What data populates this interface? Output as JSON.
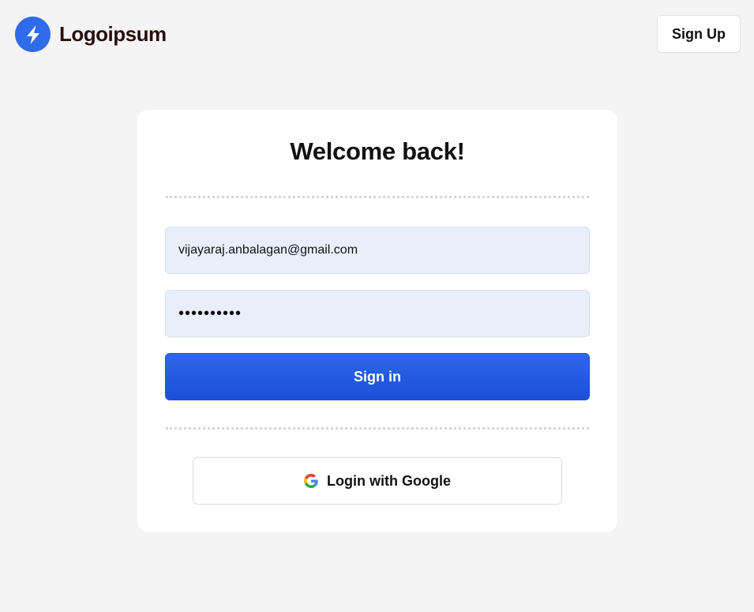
{
  "header": {
    "brand_name": "Logoipsum",
    "brand_icon": "lightning-bolt-icon",
    "signup_label": "Sign Up"
  },
  "login": {
    "title": "Welcome back!",
    "email_value": "vijayaraj.anbalagan@gmail.com",
    "password_value": "••••••••••",
    "signin_label": "Sign in",
    "google_label": "Login with Google",
    "google_icon": "google-g-icon"
  },
  "colors": {
    "background": "#f4f4f4",
    "brand_accent": "#2f6bea",
    "primary_button": "#1f57e0",
    "input_fill": "#e8effb",
    "brand_text": "#2a0d0d"
  }
}
